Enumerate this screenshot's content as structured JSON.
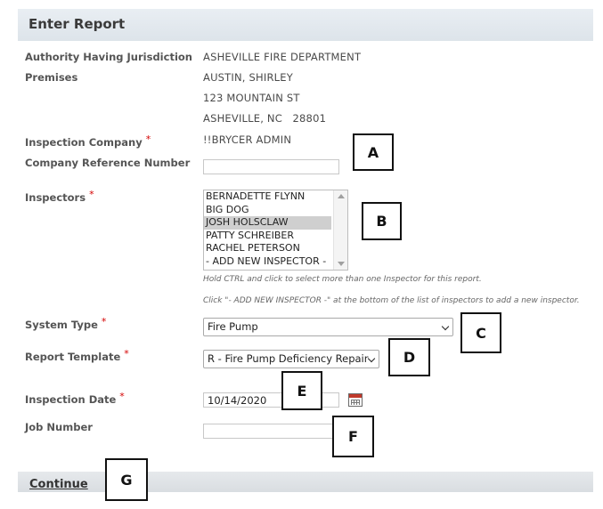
{
  "page": {
    "title": "Enter Report"
  },
  "fields": {
    "ahj_label": "Authority Having Jurisdiction",
    "ahj_value": "ASHEVILLE FIRE DEPARTMENT",
    "premises_label": "Premises",
    "premises_line1": "AUSTIN, SHIRLEY",
    "premises_line2": "123 MOUNTAIN ST",
    "premises_line3": "ASHEVILLE, NC   28801",
    "company_label": "Inspection Company",
    "company_value": "!!BRYCER ADMIN",
    "ref_label": "Company Reference Number",
    "ref_value": "",
    "inspectors_label": "Inspectors",
    "inspectors_options": [
      "BERNADETTE FLYNN",
      "BIG DOG",
      "JOSH HOLSCLAW",
      "PATTY SCHREIBER",
      "RACHEL PETERSON",
      "- ADD NEW INSPECTOR -"
    ],
    "inspectors_selected": "JOSH HOLSCLAW",
    "inspectors_hint1": "Hold CTRL and click to select more than one Inspector for this report.",
    "inspectors_hint2": "Click \"- ADD NEW INSPECTOR -\" at the bottom of the list of inspectors to add a new inspector.",
    "system_type_label": "System Type",
    "system_type_value": "Fire Pump",
    "template_label": "Report Template",
    "template_value": "R - Fire Pump Deficiency Repair",
    "date_label": "Inspection Date",
    "date_value": "10/14/2020",
    "job_label": "Job Number",
    "job_value": "",
    "required_mark": "*"
  },
  "footer": {
    "continue_label": "Continue"
  },
  "callouts": [
    "A",
    "B",
    "C",
    "D",
    "E",
    "F",
    "G"
  ],
  "icons": {
    "calendar": "calendar-icon",
    "dropdown": "chevron-down-icon"
  },
  "colors": {
    "required": "#d40000",
    "header_bg": "#e3e9ee",
    "selected_option": "#cfcfcf"
  }
}
